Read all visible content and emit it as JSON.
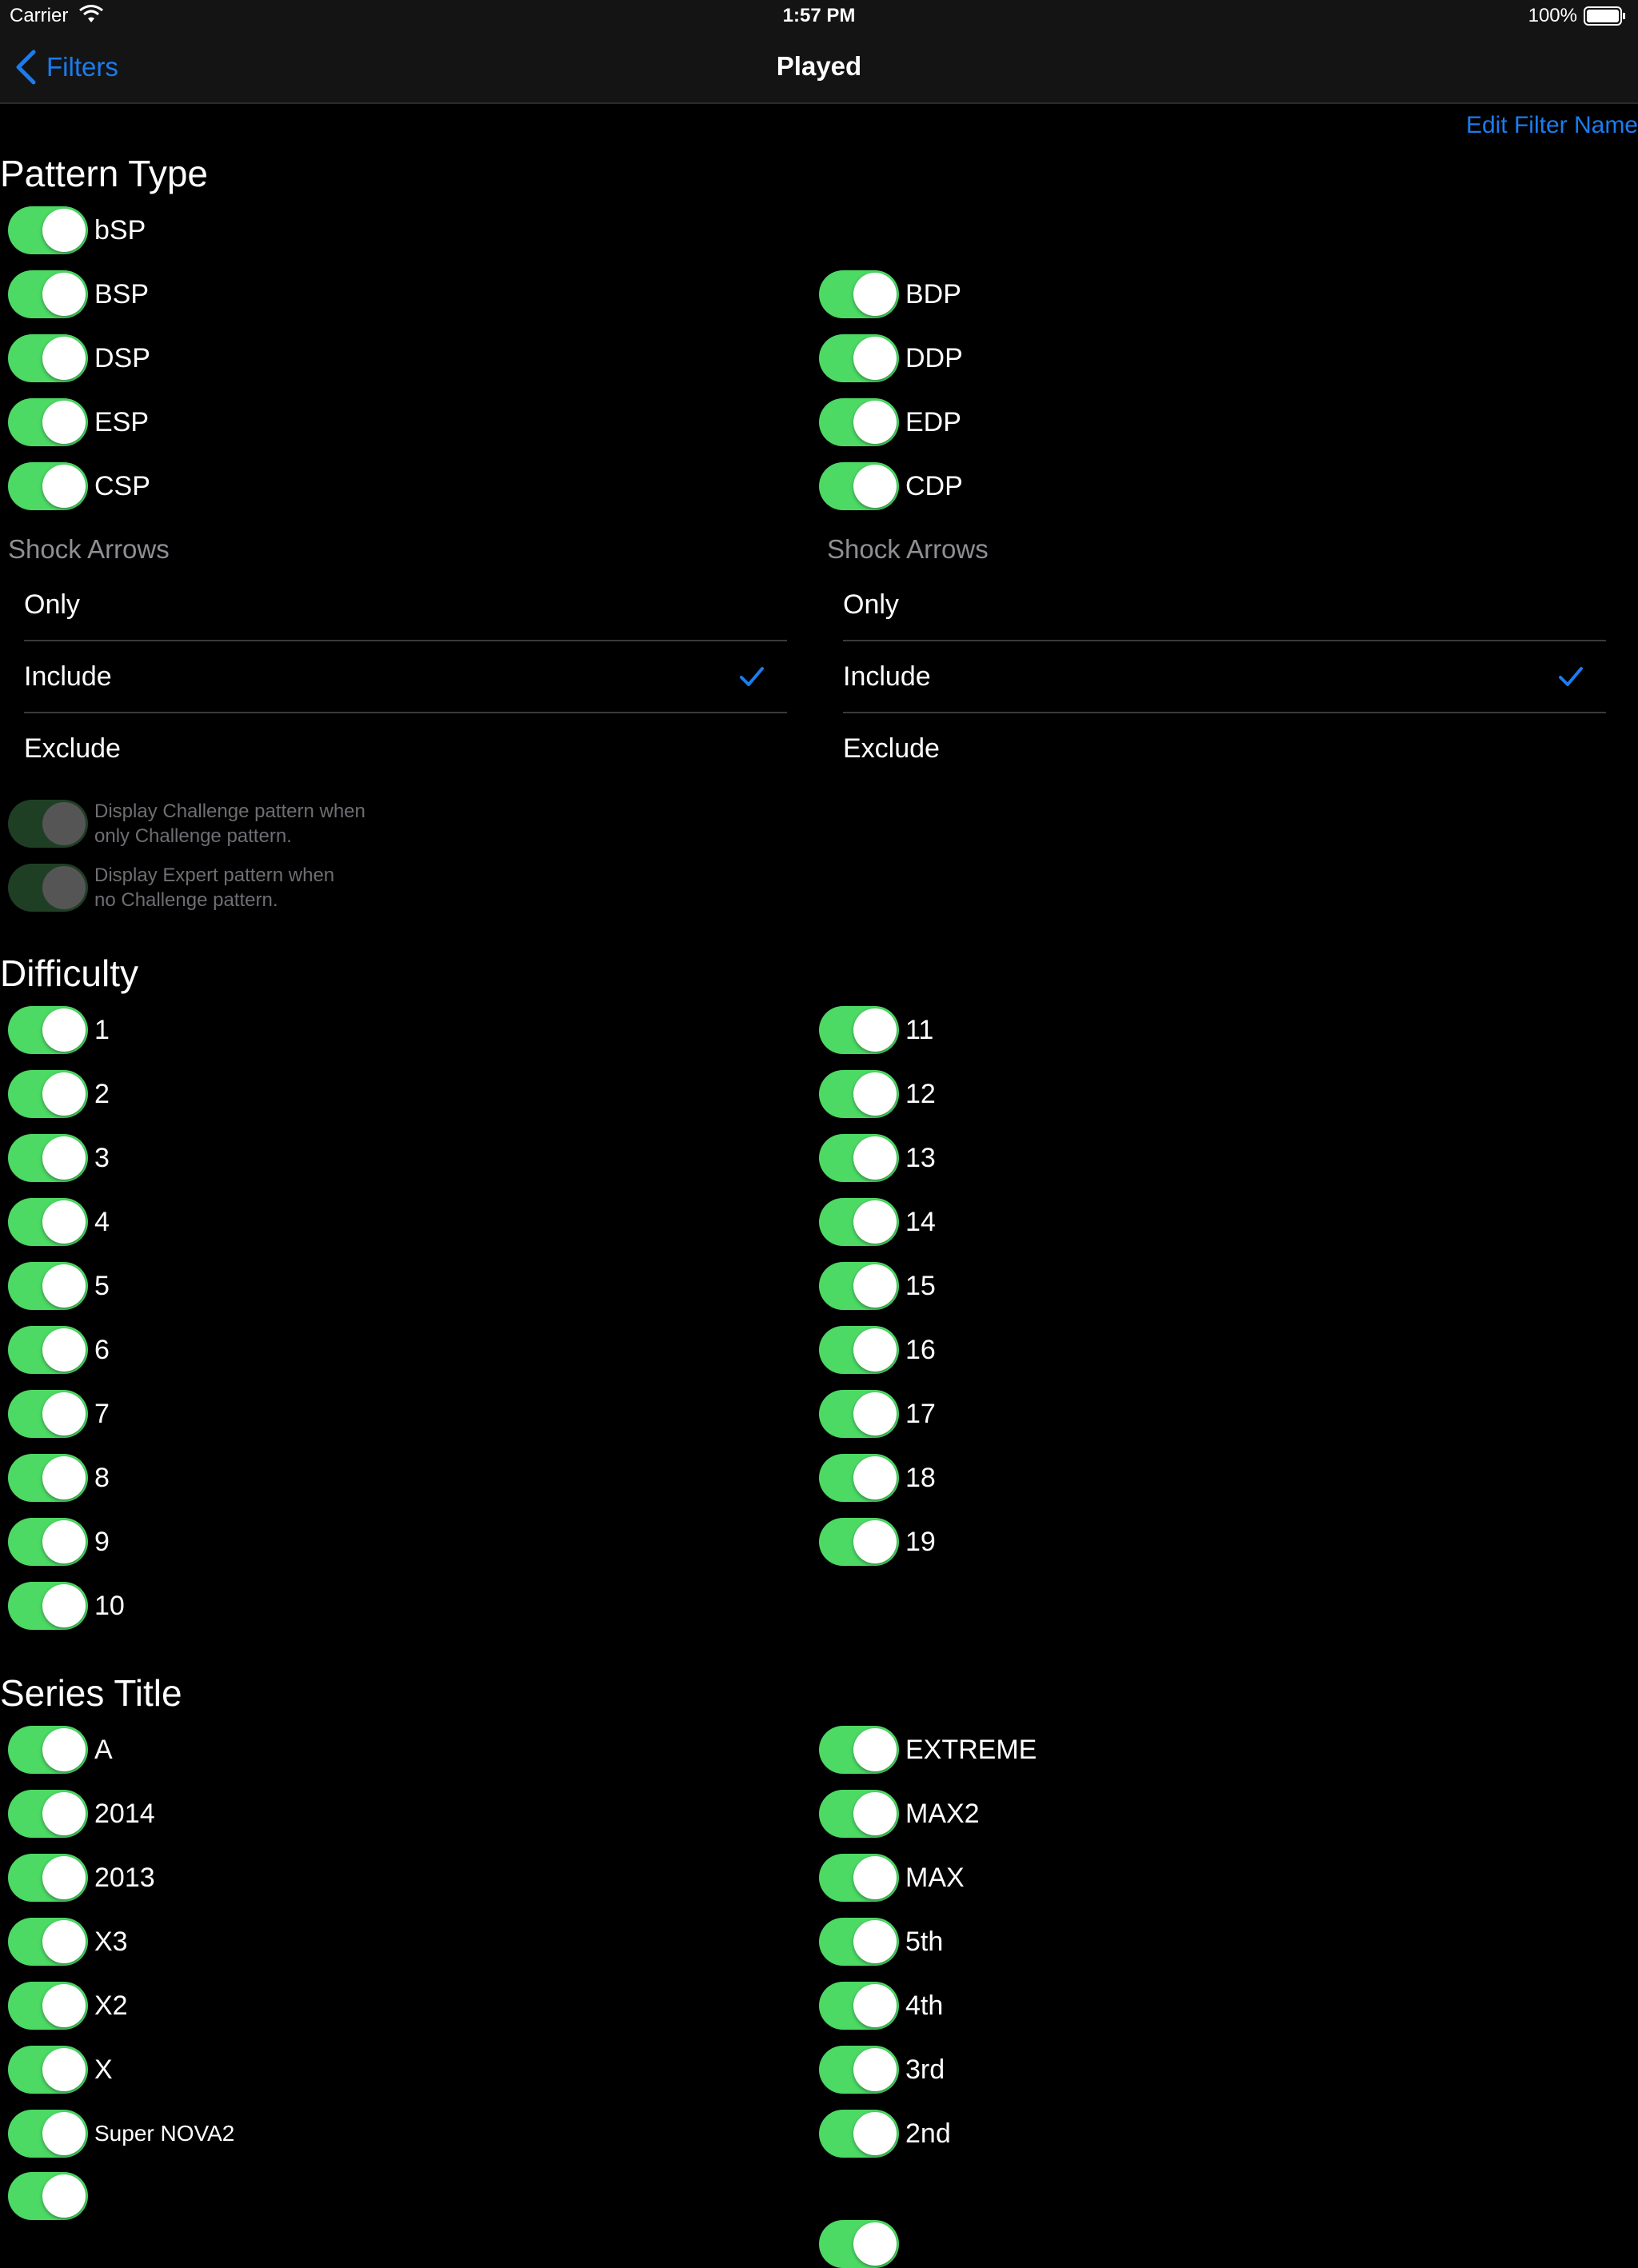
{
  "status": {
    "carrier": "Carrier",
    "time": "1:57 PM",
    "battery": "100%"
  },
  "nav": {
    "back_label": "Filters",
    "title": "Played"
  },
  "edit_filter_label": "Edit Filter Name",
  "pattern_type": {
    "heading": "Pattern Type",
    "single": [
      "bSP",
      "BSP",
      "DSP",
      "ESP",
      "CSP"
    ],
    "double": [
      "BDP",
      "DDP",
      "EDP",
      "CDP"
    ],
    "shock_title": "Shock Arrows",
    "shock_options": [
      "Only",
      "Include",
      "Exclude"
    ],
    "shock_selected_left": "Include",
    "shock_selected_right": "Include",
    "challenge_note": [
      "Display Challenge pattern when",
      "only Challenge pattern."
    ],
    "expert_note": [
      "Display Expert pattern when",
      "no Challenge pattern."
    ]
  },
  "difficulty": {
    "heading": "Difficulty",
    "left": [
      "1",
      "2",
      "3",
      "4",
      "5",
      "6",
      "7",
      "8",
      "9",
      "10"
    ],
    "right": [
      "11",
      "12",
      "13",
      "14",
      "15",
      "16",
      "17",
      "18",
      "19"
    ]
  },
  "series_title": {
    "heading": "Series Title",
    "left": [
      "A",
      "2014",
      "2013",
      "X3",
      "X2",
      "X",
      "Super NOVA2"
    ],
    "right": [
      "EXTREME",
      "MAX2",
      "MAX",
      "5th",
      "4th",
      "3rd",
      "2nd"
    ]
  },
  "colors": {
    "accent": "#1b7cf0",
    "switch_on": "#4cd964",
    "background": "#000000"
  }
}
